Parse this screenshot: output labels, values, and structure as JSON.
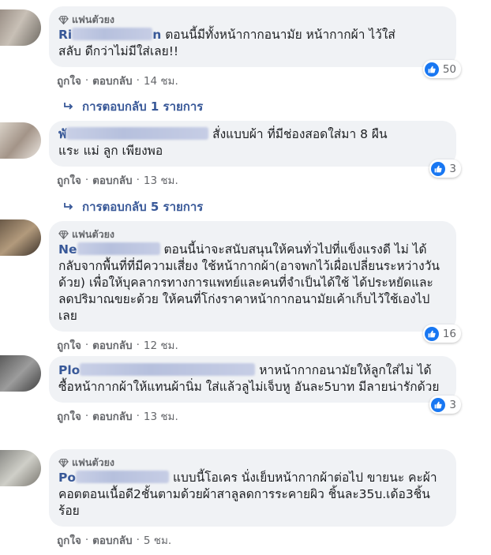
{
  "comments": [
    {
      "badge": "แฟนตัวยง",
      "author_visible": "Ri",
      "author_tail": "n",
      "text_line1": "ตอนนี้มีทั้งหน้ากากอนามัย หน้ากากผ้า ไว้ใส่",
      "text_rest": "สลับ ดีกว่าไม่มีใส่เลย!!",
      "likes": "50",
      "like_label": "ถูกใจ",
      "reply_label": "ตอบกลับ",
      "time": "14 ชม.",
      "replies_label": "การตอบกลับ 1 รายการ"
    },
    {
      "badge": "",
      "author_visible": "พั",
      "author_tail": "",
      "text_line1": "สั่งแบบผ้า ที่มีช่องสอดใส่มา 8 ผืน",
      "text_rest": "แระ แม่ ลูก เพียงพอ",
      "likes": "3",
      "like_label": "ถูกใจ",
      "reply_label": "ตอบกลับ",
      "time": "13 ชม.",
      "replies_label": "การตอบกลับ 5 รายการ"
    },
    {
      "badge": "แฟนตัวยง",
      "author_visible": "Ne",
      "author_tail": "",
      "text_line1": "ตอนนี้น่าจะสนับสนุนให้คนทั่วไปที่แข็งแรงดี ไม่",
      "text_rest": "ได้กลับจากพื้นที่ที่มีความเสี่ยง ใช้หน้ากากผ้า(อาจพกไว้เผื่อเปลี่ยนระหว่างวันด้วย) เพื่อให้บุคลากรทางการแพทย์และคนที่จำเป็นได้ใช้ ได้ประหยัดและลดปริมาณขยะด้วย ให้คนที่โก่งราคาหน้ากากอนามัยเค้าเก็บไว้ใช้เองไปเลย",
      "likes": "16",
      "like_label": "ถูกใจ",
      "reply_label": "ตอบกลับ",
      "time": "12 ชม."
    },
    {
      "badge": "",
      "author_visible": "Plo",
      "author_tail": "",
      "text_line1": "หาหน้ากากอนามัยให้ลูกใส่ไม่",
      "text_rest": "ได้ ซื้อหน้ากากผ้าให้แทนผ้านิ่ม ใส่แล้วลูไม่เจ็บหู อันละ5บาท มีลายน่ารักด้วย",
      "likes": "3",
      "like_label": "ถูกใจ",
      "reply_label": "ตอบกลับ",
      "time": "13 ชม."
    },
    {
      "badge": "แฟนตัวยง",
      "author_visible": "Po",
      "author_tail": "",
      "text_line1": "แบบนี้โอเคร นั่งเย็บหน้ากากผ้าต่อไป ขายนะ",
      "text_rest": "คะผ้าคอตตอนเนื้อดี2ชั้นตามด้วยผ้าสาลูลดการระคายผิว ชิ้นละ35บ.เด้อ3ชิ้นร้อย",
      "like_label": "ถูกใจ",
      "reply_label": "ตอบกลับ",
      "time": "5 ชม."
    }
  ],
  "colors": {
    "bubble": "#f0f2f5",
    "author": "#385898",
    "meta": "#65676b",
    "like_blue": "#1877f2"
  }
}
